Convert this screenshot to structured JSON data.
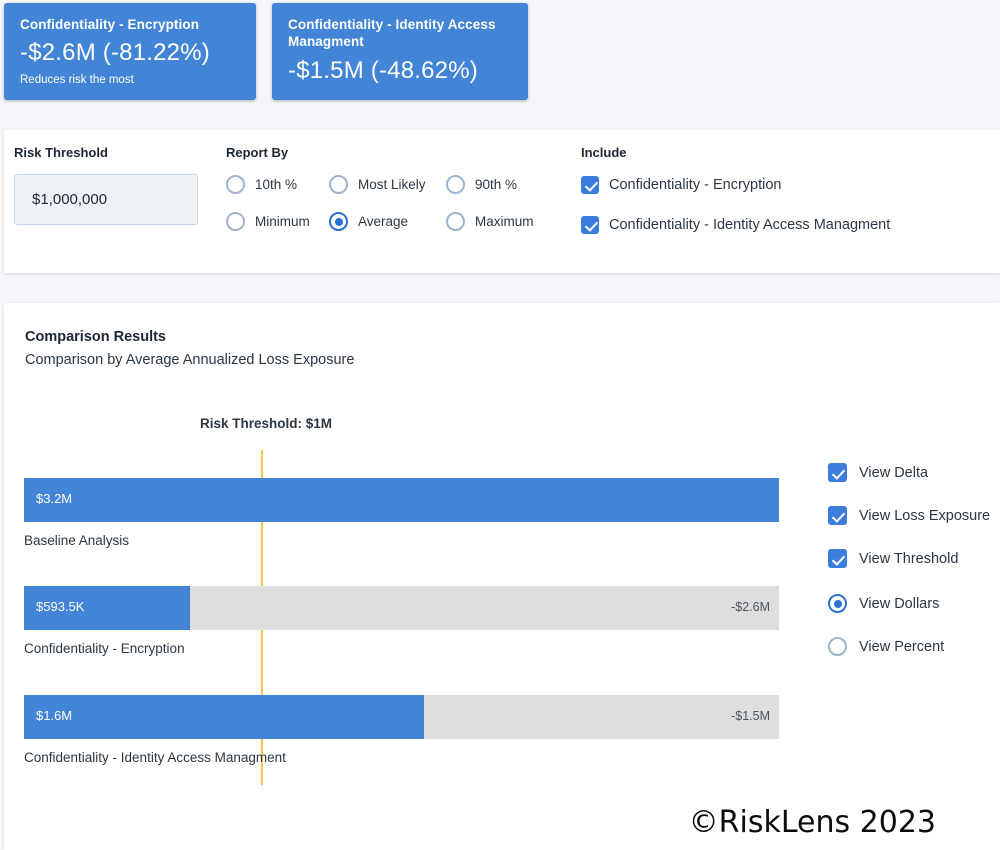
{
  "summary_cards": [
    {
      "title": "Confidentiality - Encryption",
      "value": "-$2.6M (-81.22%)",
      "note": "Reduces risk the most"
    },
    {
      "title": "Confidentiality - Identity Access Managment",
      "value": "-$1.5M (-48.62%)",
      "note": ""
    }
  ],
  "filters": {
    "risk_threshold": {
      "label": "Risk Threshold",
      "value": "$1,000,000"
    },
    "report_by": {
      "label": "Report By",
      "selected": "Average",
      "options": [
        {
          "label": "10th %",
          "checked": false
        },
        {
          "label": "Most Likely",
          "checked": false
        },
        {
          "label": "90th %",
          "checked": false
        },
        {
          "label": "Minimum",
          "checked": false
        },
        {
          "label": "Average",
          "checked": true
        },
        {
          "label": "Maximum",
          "checked": false
        }
      ]
    },
    "include": {
      "label": "Include",
      "options": [
        {
          "label": "Confidentiality - Encryption",
          "checked": true
        },
        {
          "label": "Confidentiality - Identity Access Managment",
          "checked": true
        }
      ]
    }
  },
  "results": {
    "title": "Comparison Results",
    "subtitle": "Comparison by Average Annualized Loss Exposure",
    "legend": [
      {
        "label": "View Delta",
        "type": "checkbox",
        "checked": true
      },
      {
        "label": "View Loss Exposure",
        "type": "checkbox",
        "checked": true
      },
      {
        "label": "View Threshold",
        "type": "checkbox",
        "checked": true
      },
      {
        "label": "View Dollars",
        "type": "radio",
        "checked": true
      },
      {
        "label": "View Percent",
        "type": "radio",
        "checked": false
      }
    ]
  },
  "chart_data": {
    "type": "bar",
    "orientation": "horizontal",
    "title": "Comparison Results",
    "subtitle": "Comparison by Average Annualized Loss Exposure",
    "xlabel": "",
    "ylabel": "",
    "threshold_caption": "Risk Threshold: $1M",
    "threshold_value": 1000000,
    "threshold_color": "#f6c544",
    "bar_color": "#4285d6",
    "track_color": "#dedede",
    "axis_max": 3200000,
    "categories": [
      "Baseline Analysis",
      "Confidentiality - Encryption",
      "Confidentiality - Identity Access Managment"
    ],
    "values": [
      3200000,
      593500,
      1600000
    ],
    "value_labels": [
      "$3.2M",
      "$593.5K",
      "$1.6M"
    ],
    "delta_labels": [
      "",
      "-$2.6M",
      "-$1.5M"
    ],
    "bar_fill_pct": [
      100,
      22,
      53
    ]
  },
  "watermark": "©RiskLens 2023"
}
